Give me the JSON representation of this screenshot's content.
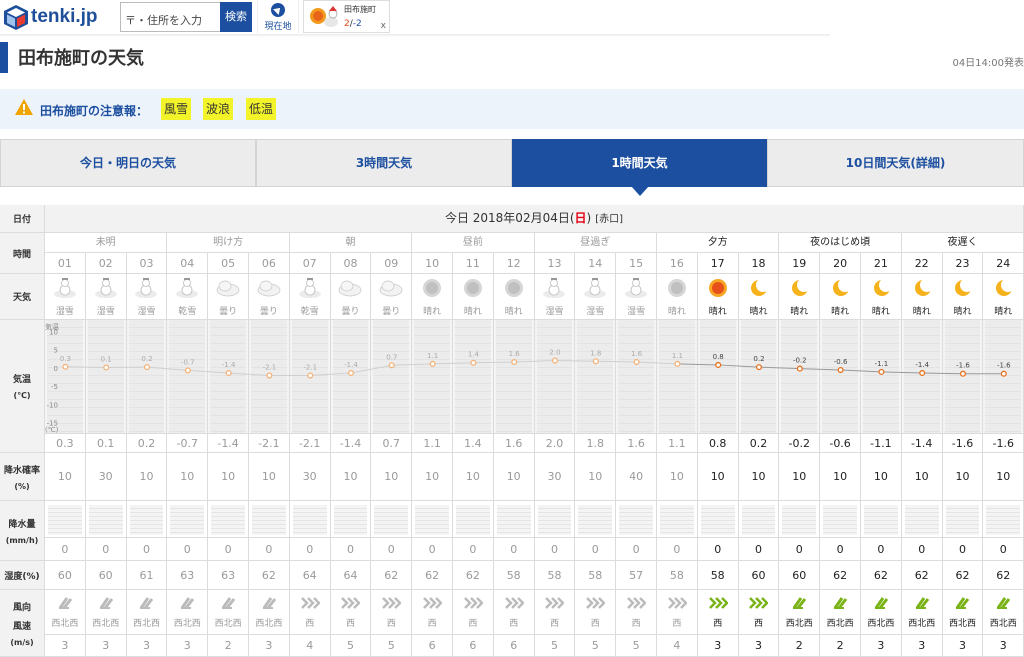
{
  "header": {
    "logo_text": "tenki.jp",
    "search_placeholder": "〒・住所を入力",
    "search_button": "検索",
    "current_location": "現在地",
    "mini_card": {
      "city": "田布施町",
      "high": "2",
      "low": "-2",
      "close": "x"
    }
  },
  "page": {
    "title": "田布施町の天気",
    "published": "04日14:00発表"
  },
  "warning": {
    "label": "田布施町の注意報：",
    "items": [
      "風雪",
      "波浪",
      "低温"
    ]
  },
  "tabs": [
    {
      "label": "今日・明日の天気",
      "active": false
    },
    {
      "label": "3時間天気",
      "active": false
    },
    {
      "label": "1時間天気",
      "active": true
    },
    {
      "label": "10日間天気(詳細)",
      "active": false
    }
  ],
  "table": {
    "row_labels": {
      "date": "日付",
      "time": "時間",
      "weather": "天気",
      "temp": "気温",
      "temp_unit": "(℃)",
      "precip_prob": "降水確率",
      "precip_prob_unit": "(%)",
      "precip": "降水量",
      "precip_unit": "(mm/h)",
      "humidity": "湿度(%)",
      "wind_dir": "風向",
      "wind_speed": "風速",
      "wind_unit": "(m/s)"
    },
    "date_text": "今日 2018年02月04日(",
    "date_day": "日",
    "date_close": ")",
    "rokuyo": "[赤口]",
    "periods": [
      {
        "label": "未明",
        "span": 3
      },
      {
        "label": "明け方",
        "span": 3
      },
      {
        "label": "朝",
        "span": 3
      },
      {
        "label": "昼前",
        "span": 3
      },
      {
        "label": "昼過ぎ",
        "span": 3
      },
      {
        "label": "夕方",
        "span": 3
      },
      {
        "label": "夜のはじめ頃",
        "span": 3
      },
      {
        "label": "夜遅く",
        "span": 3
      }
    ],
    "hours": [
      "01",
      "02",
      "03",
      "04",
      "05",
      "06",
      "07",
      "08",
      "09",
      "10",
      "11",
      "12",
      "13",
      "14",
      "15",
      "16",
      "17",
      "18",
      "19",
      "20",
      "21",
      "22",
      "23",
      "24"
    ],
    "weather": [
      "湿雪",
      "湿雪",
      "湿雪",
      "乾雪",
      "曇り",
      "曇り",
      "乾雪",
      "曇り",
      "曇り",
      "晴れ",
      "晴れ",
      "晴れ",
      "湿雪",
      "湿雪",
      "湿雪",
      "晴れ",
      "晴れ",
      "晴れ",
      "晴れ",
      "晴れ",
      "晴れ",
      "晴れ",
      "晴れ",
      "晴れ"
    ],
    "weather_icons": [
      "snowman-icon",
      "snowman-icon",
      "snowman-icon",
      "snowman-icon",
      "cloud-icon",
      "cloud-icon",
      "snowman-icon",
      "cloud-icon",
      "cloud-icon",
      "sun-icon",
      "sun-icon",
      "sun-icon",
      "snowman-icon",
      "snowman-icon",
      "snowman-icon",
      "sun-icon",
      "sun-icon",
      "moon-icon",
      "moon-icon",
      "moon-icon",
      "moon-icon",
      "moon-icon",
      "moon-icon",
      "moon-icon"
    ],
    "temps": [
      "0.3",
      "0.1",
      "0.2",
      "-0.7",
      "-1.4",
      "-2.1",
      "-2.1",
      "-1.4",
      "0.7",
      "1.1",
      "1.4",
      "1.6",
      "2.0",
      "1.8",
      "1.6",
      "1.1",
      "0.8",
      "0.2",
      "-0.2",
      "-0.6",
      "-1.1",
      "-1.4",
      "-1.6",
      "-1.6"
    ],
    "temp_axis": {
      "unit_top": "気温",
      "unit_bottom": "(℃)",
      "ticks": [
        "10",
        "5",
        "0",
        "-5",
        "-10",
        "-15"
      ]
    },
    "precip_prob": [
      "10",
      "30",
      "10",
      "10",
      "10",
      "10",
      "30",
      "10",
      "10",
      "10",
      "10",
      "10",
      "30",
      "10",
      "40",
      "10",
      "10",
      "10",
      "10",
      "10",
      "10",
      "10",
      "10",
      "10"
    ],
    "precip": [
      "0",
      "0",
      "0",
      "0",
      "0",
      "0",
      "0",
      "0",
      "0",
      "0",
      "0",
      "0",
      "0",
      "0",
      "0",
      "0",
      "0",
      "0",
      "0",
      "0",
      "0",
      "0",
      "0",
      "0"
    ],
    "humidity": [
      "60",
      "60",
      "61",
      "63",
      "63",
      "62",
      "64",
      "64",
      "62",
      "62",
      "62",
      "58",
      "58",
      "58",
      "57",
      "58",
      "58",
      "60",
      "60",
      "62",
      "62",
      "62",
      "62",
      "62"
    ],
    "wind_dir": [
      "西北西",
      "西北西",
      "西北西",
      "西北西",
      "西北西",
      "西北西",
      "西",
      "西",
      "西",
      "西",
      "西",
      "西",
      "西",
      "西",
      "西",
      "西",
      "西",
      "西",
      "西北西",
      "西北西",
      "西北西",
      "西北西",
      "西北西",
      "西北西"
    ],
    "wind_speed": [
      "3",
      "3",
      "3",
      "3",
      "2",
      "3",
      "4",
      "5",
      "5",
      "6",
      "6",
      "6",
      "5",
      "5",
      "5",
      "4",
      "3",
      "3",
      "2",
      "2",
      "3",
      "3",
      "3",
      "3"
    ],
    "current_index": 16,
    "chart_data": {
      "type": "line",
      "x": [
        "01",
        "02",
        "03",
        "04",
        "05",
        "06",
        "07",
        "08",
        "09",
        "10",
        "11",
        "12",
        "13",
        "14",
        "15",
        "16",
        "17",
        "18",
        "19",
        "20",
        "21",
        "22",
        "23",
        "24"
      ],
      "series": [
        {
          "name": "気温",
          "values": [
            0.3,
            0.1,
            0.2,
            -0.7,
            -1.4,
            -2.1,
            -2.1,
            -1.4,
            0.7,
            1.1,
            1.4,
            1.6,
            2.0,
            1.8,
            1.6,
            1.1,
            0.8,
            0.2,
            -0.2,
            -0.6,
            -1.1,
            -1.4,
            -1.6,
            -1.6
          ]
        }
      ],
      "ylim": [
        -17,
        12
      ],
      "color_past": "#f3b27a",
      "color_future": "#e8701d"
    }
  },
  "colors": {
    "brand": "#1d4fa0",
    "sunday": "#e60012",
    "badge": "#f3f32a"
  }
}
